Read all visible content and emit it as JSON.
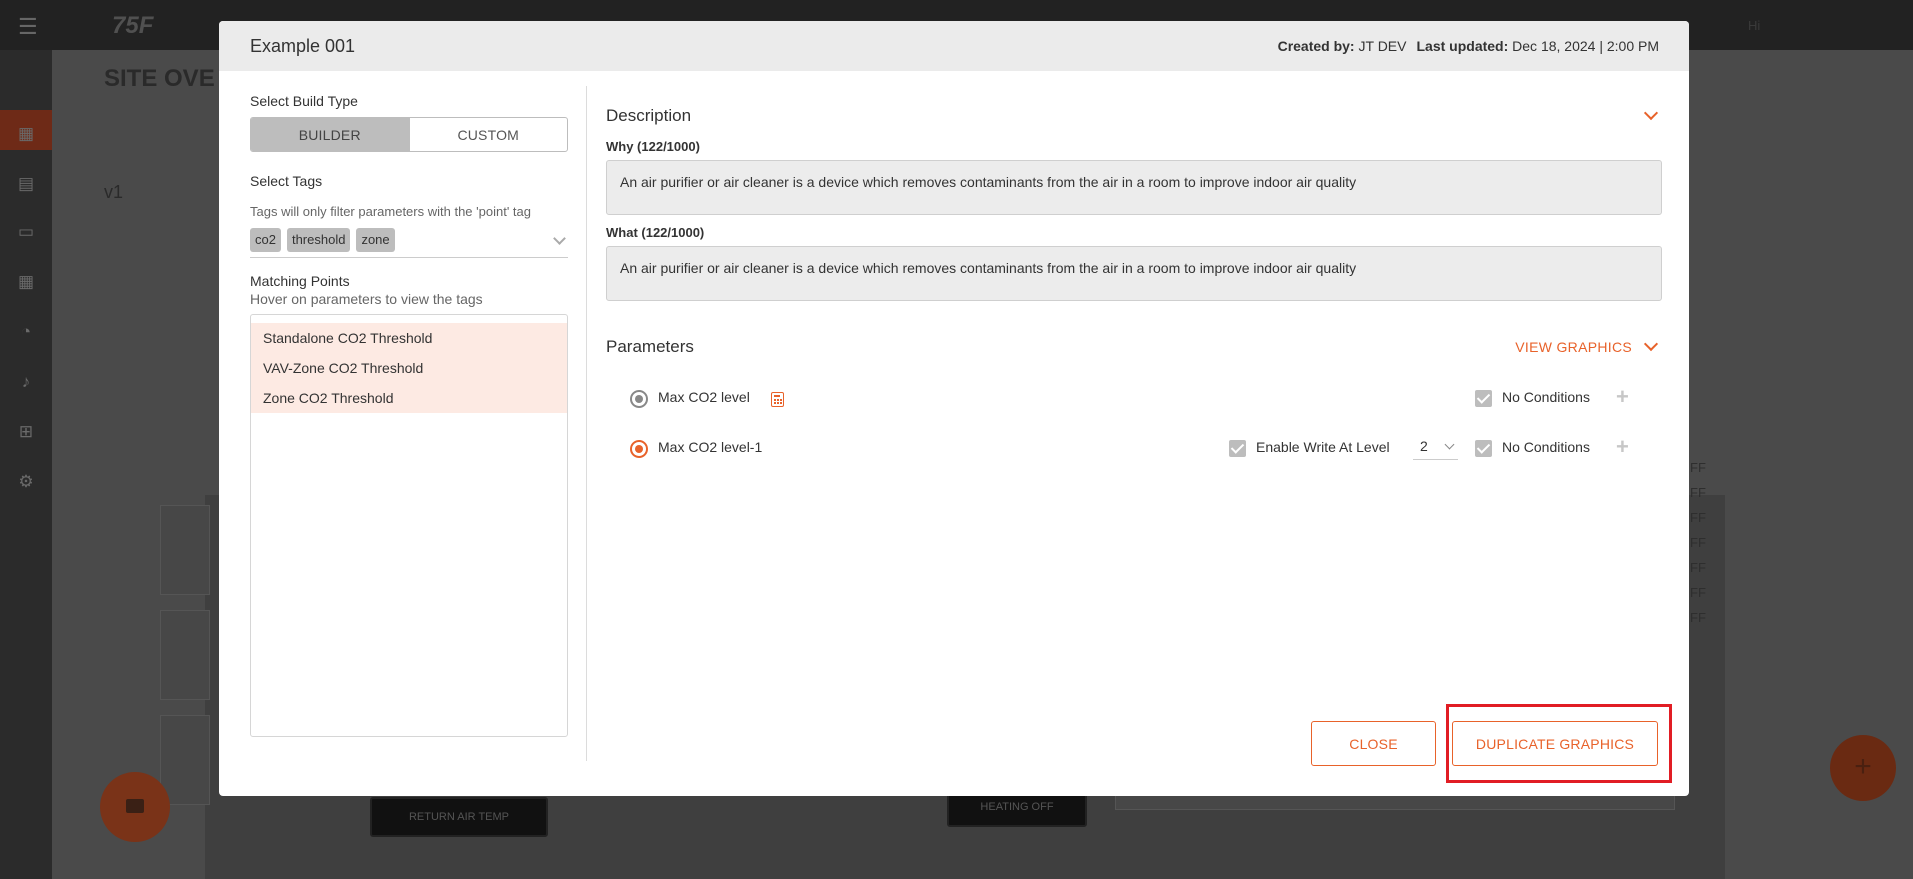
{
  "background": {
    "logo": "75F",
    "page_title": "SITE OVE",
    "version_label": "v1",
    "buttons": [
      "RETURN AIR TEMP",
      "HEATING OFF"
    ],
    "status_lines": [
      "FF",
      "FF",
      "FF",
      "FF",
      "FF",
      "FF",
      "FF"
    ],
    "user_label": "Hi"
  },
  "modal": {
    "title": "Example 001",
    "created_by_label": "Created by:",
    "created_by": "JT DEV",
    "last_updated_label": "Last updated:",
    "last_updated": "Dec 18, 2024 | 2:00 PM"
  },
  "build_type": {
    "label": "Select Build Type",
    "options": [
      "BUILDER",
      "CUSTOM"
    ],
    "selected": "BUILDER"
  },
  "tags": {
    "label": "Select Tags",
    "hint": "Tags will only filter parameters with the 'point' tag",
    "selected": [
      "co2",
      "threshold",
      "zone"
    ]
  },
  "matching_points": {
    "label": "Matching Points",
    "hint": "Hover on parameters to view the tags",
    "items": [
      "Standalone CO2 Threshold",
      "VAV-Zone CO2 Threshold",
      "Zone CO2 Threshold"
    ]
  },
  "description": {
    "title": "Description",
    "why_label": "Why (122/1000)",
    "why_value": "An air purifier or air cleaner is a device which removes contaminants from the air in a room to improve indoor air quality",
    "what_label": "What (122/1000)",
    "what_value": "An air purifier or air cleaner is a device which removes contaminants from the air in a room to improve indoor air quality"
  },
  "parameters": {
    "title": "Parameters",
    "view_graphics": "VIEW GRAPHICS",
    "rows": [
      {
        "name": "Max CO2 level",
        "conditions_label": "No Conditions"
      },
      {
        "name": "Max CO2 level-1",
        "enable_write_label": "Enable Write At Level",
        "level": "2",
        "conditions_label": "No Conditions"
      }
    ]
  },
  "actions": {
    "close": "CLOSE",
    "duplicate": "DUPLICATE GRAPHICS"
  },
  "colors": {
    "accent": "#e8622a",
    "highlight": "#e11d24"
  }
}
